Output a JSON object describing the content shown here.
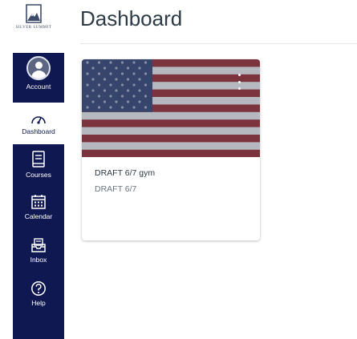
{
  "header": {
    "title": "Dashboard",
    "logo_text": "SILVER SUMMIT"
  },
  "nav": {
    "items": [
      {
        "id": "account",
        "label": "Account",
        "icon": "account-icon"
      },
      {
        "id": "dashboard",
        "label": "Dashboard",
        "icon": "dashboard-icon",
        "active": true
      },
      {
        "id": "courses",
        "label": "Courses",
        "icon": "courses-icon"
      },
      {
        "id": "calendar",
        "label": "Calendar",
        "icon": "calendar-icon"
      },
      {
        "id": "inbox",
        "label": "Inbox",
        "icon": "inbox-icon"
      },
      {
        "id": "help",
        "label": "Help",
        "icon": "help-icon"
      }
    ]
  },
  "courses": [
    {
      "title": "DRAFT 6/7 gym",
      "subtitle": "DRAFT 6/7",
      "image": "us-flag-image",
      "menu_icon": "kebab-menu-icon"
    }
  ],
  "colors": {
    "nav_bg": "#101851",
    "title_text": "#2d3b45",
    "flag_red": "#8c3c46",
    "flag_white": "#cfd2da",
    "flag_blue": "#3f4e7a"
  }
}
